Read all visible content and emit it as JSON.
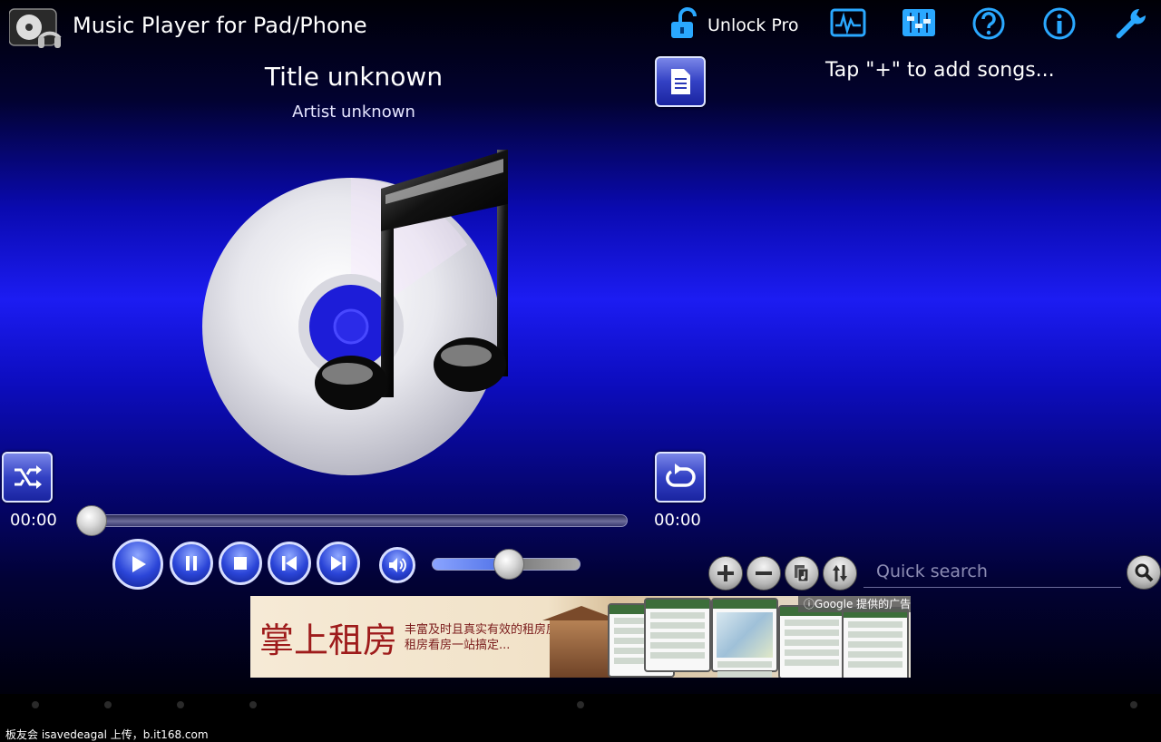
{
  "header": {
    "app_title": "Music Player for Pad/Phone",
    "unlock_label": "Unlock Pro",
    "icons": [
      "visualizer-icon",
      "equalizer-icon",
      "help-icon",
      "info-icon",
      "settings-wrench-icon"
    ]
  },
  "player": {
    "title": "Title unknown",
    "artist": "Artist unknown",
    "elapsed": "00:00",
    "duration": "00:00",
    "seek_progress": 0,
    "volume_level": 0.52
  },
  "playlist": {
    "hint": "Tap \"+\" to add songs...",
    "search_placeholder": "Quick search"
  },
  "ad": {
    "headline": "掌上租房",
    "line1": "丰富及时且真实有效的租房房源",
    "line2": "租房看房一站搞定...",
    "attribution": "Google 提供的广告"
  },
  "watermark": "板友会 isavedeagal 上传，b.it168.com",
  "colors": {
    "accent_blue": "#1c1cf2",
    "icon_cyan": "#2aa8ff"
  }
}
